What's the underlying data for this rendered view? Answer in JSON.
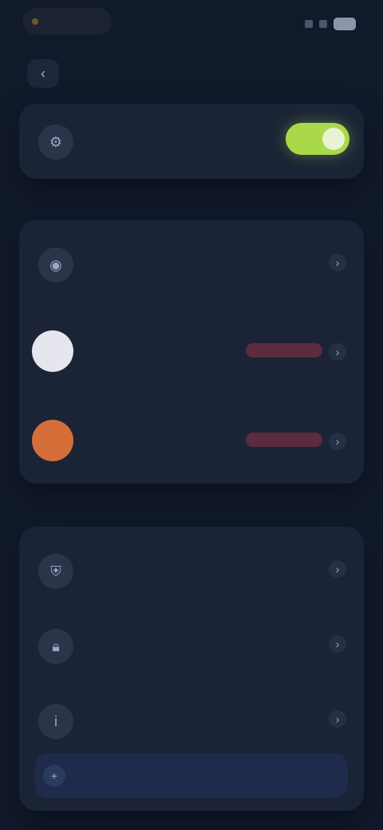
{
  "header": {
    "title": "",
    "back_icon": "chevron-left-icon"
  },
  "sections": {
    "section1_label": "",
    "section2_label": ""
  },
  "items": {
    "top_toggle": {
      "label": "",
      "subtitle": "",
      "icon": "gear-icon",
      "toggle_on": true,
      "accent": "#a9d94a"
    },
    "top_list": {
      "label": "",
      "subtitle": "",
      "icon": "user-icon"
    },
    "app_1": {
      "label": "",
      "subtitle": "",
      "avatar_color": "#e6e6ef",
      "status_color": "#5b2b3f"
    },
    "app_2": {
      "label": "",
      "subtitle": "",
      "avatar_color": "#d66e3a",
      "status_color": "#5b2b3f"
    },
    "bottom_1": {
      "label": "",
      "subtitle": "",
      "icon": "shield-icon"
    },
    "bottom_2": {
      "label": "",
      "subtitle": "",
      "icon": "lock-icon"
    },
    "bottom_3": {
      "label": "",
      "subtitle": "",
      "icon": "info-icon"
    }
  },
  "bottom_bar": {
    "label": "",
    "icon": "plus-icon"
  }
}
